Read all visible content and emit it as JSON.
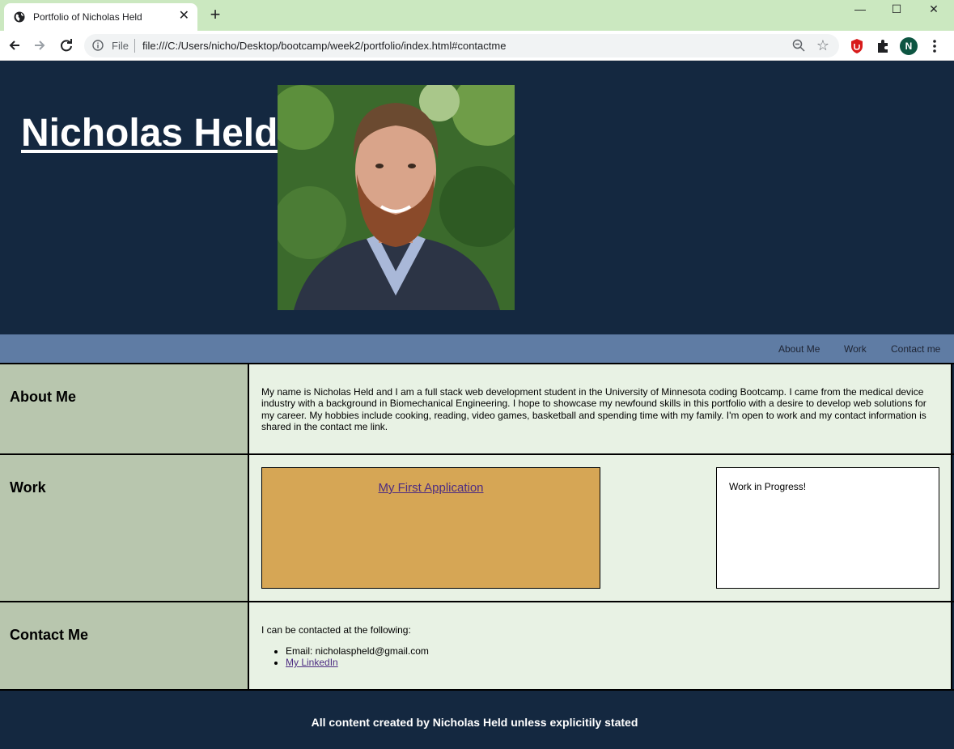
{
  "browser": {
    "tab_title": "Portfolio of Nicholas Held",
    "tab_close": "✕",
    "new_tab": "+",
    "omnibox_scheme": "File",
    "url": "file:///C:/Users/nicho/Desktop/bootcamp/week2/portfolio/index.html#contactme",
    "profile_initial": "N",
    "window_controls": [
      "—",
      "☐",
      "✕"
    ]
  },
  "header": {
    "title": "Nicholas Held"
  },
  "nav": {
    "items": [
      {
        "label": "About Me"
      },
      {
        "label": "Work"
      },
      {
        "label": "Contact me"
      }
    ]
  },
  "about": {
    "heading": "About Me",
    "text": "My name is Nicholas Held and I am a full stack web development student in the University of Minnesota coding Bootcamp. I came from the medical device industry with a background in Biomechanical Engineering. I hope to showcase my newfound skills in this portfolio with a desire to develop web solutions for my career. My hobbies include cooking, reading, video games, basketball and spending time with my family. I'm open to work and my contact information is shared in the contact me link."
  },
  "work": {
    "heading": "Work",
    "project_link": "My First Application",
    "wip_text": "Work in Progress!"
  },
  "contact": {
    "heading": "Contact Me",
    "intro": "I can be contacted at the following:",
    "email_line": "Email: nicholaspheld@gmail.com",
    "linkedin": "My LinkedIn"
  },
  "footer": {
    "text": "All content created by Nicholas Held unless explicitily stated"
  },
  "colors": {
    "tabstrip": "#cbe8c0",
    "page_bg": "#142840",
    "navbar": "#5f7ca4",
    "sidebar": "#b8c6ae",
    "content": "#e8f2e4",
    "project_card": "#d6a655",
    "link": "#4d2c82"
  },
  "icons": [
    "globe-icon",
    "back-arrow-icon",
    "forward-arrow-icon",
    "reload-icon",
    "info-icon",
    "zoom-out-icon",
    "star-icon",
    "extension-icon",
    "puzzle-icon",
    "kebab-menu-icon"
  ]
}
